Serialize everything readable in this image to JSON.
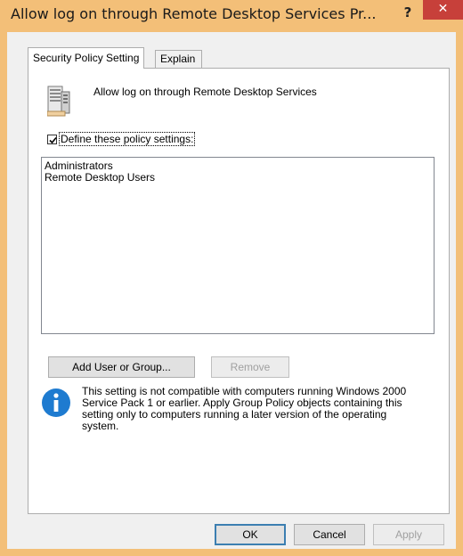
{
  "window": {
    "title": "Allow log on through Remote Desktop Services Pr...",
    "help_symbol": "?",
    "close_symbol": "✕"
  },
  "tabs": [
    {
      "label": "Security Policy Setting",
      "selected": true
    },
    {
      "label": "Explain",
      "selected": false
    }
  ],
  "policy": {
    "icon": "policy-document-icon",
    "name": "Allow log on through Remote Desktop Services"
  },
  "define_settings": {
    "label": "Define these policy settings:",
    "checked": true
  },
  "members": [
    "Administrators",
    "Remote Desktop Users"
  ],
  "buttons": {
    "add": "Add User or Group...",
    "remove": "Remove",
    "ok": "OK",
    "cancel": "Cancel",
    "apply": "Apply"
  },
  "info": {
    "icon": "info-icon",
    "text": "This setting is not compatible with computers running Windows 2000 Service Pack 1 or earlier.  Apply Group Policy objects containing this setting only to computers running a later version of the operating system."
  },
  "colors": {
    "titlebar": "#f3bf78",
    "close_button": "#c7403a",
    "info_icon": "#1e7bd0"
  }
}
